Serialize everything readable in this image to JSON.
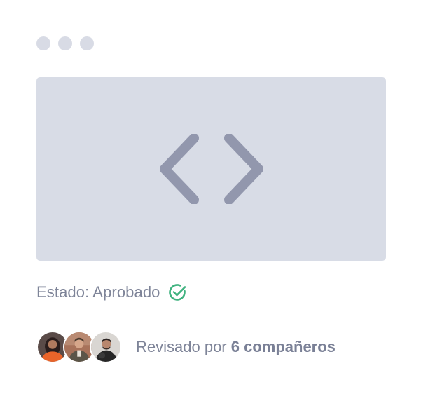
{
  "window": {
    "controls": [
      "window-dot",
      "window-dot",
      "window-dot"
    ]
  },
  "preview": {
    "icon": "code-brackets-icon"
  },
  "status": {
    "text": "Estado: Aprobado",
    "icon": "check-circle-icon",
    "icon_color": "#3fb27f"
  },
  "reviewers": {
    "avatars": [
      "avatar-1",
      "avatar-2",
      "avatar-3"
    ],
    "text_prefix": "Revisado por ",
    "text_strong": "6 compañeros"
  },
  "colors": {
    "preview_bg": "#d8dce6",
    "icon_gray": "#9297ad",
    "dot": "#d8dbe5",
    "text": "#7e8498"
  }
}
